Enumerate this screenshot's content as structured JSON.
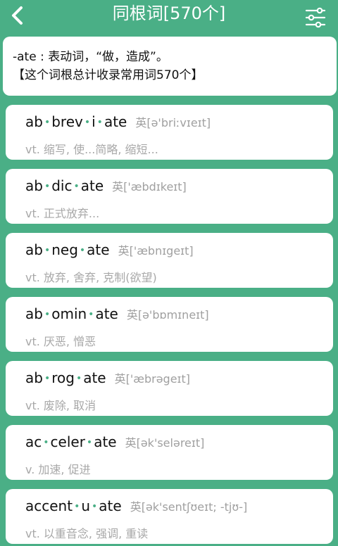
{
  "header": {
    "title": "同根词[570个]",
    "back_icon": "chevron-left-icon",
    "filter_icon": "sliders-icon"
  },
  "intro": {
    "line1": "-ate : 表动词，“做，造成”。",
    "line2": "【这个词根总计收录常用词570个】"
  },
  "words": [
    {
      "parts": [
        "ab",
        "brev",
        "i",
        "ate"
      ],
      "phonetic": "英[ə'briːvɪeɪt]",
      "meaning": "vt. 缩写, 使...简略, 缩短..."
    },
    {
      "parts": [
        "ab",
        "dic",
        "ate"
      ],
      "phonetic": "英['æbdɪkeɪt]",
      "meaning": "vt. 正式放弃..."
    },
    {
      "parts": [
        "ab",
        "neg",
        "ate"
      ],
      "phonetic": "英['æbnɪgeɪt]",
      "meaning": "vt. 放弃, 舍弃, 克制(欲望)"
    },
    {
      "parts": [
        "ab",
        "omin",
        "ate"
      ],
      "phonetic": "英[ə'bɒmɪneɪt]",
      "meaning": "vt. 厌恶, 憎恶"
    },
    {
      "parts": [
        "ab",
        "rog",
        "ate"
      ],
      "phonetic": "英['æbrəgeɪt]",
      "meaning": "vt. 废除, 取消"
    },
    {
      "parts": [
        "ac",
        "celer",
        "ate"
      ],
      "phonetic": "英[ək'seləreɪt]",
      "meaning": "v. 加速, 促进"
    },
    {
      "parts": [
        "accent",
        "u",
        "ate"
      ],
      "phonetic": "英[ək'sentʃʊeɪt; -tjʊ-]",
      "meaning": "vt. 以重音念, 强调, 重读"
    }
  ],
  "colors": {
    "background": "#4aaf86",
    "card": "#ffffff",
    "syllable_dot": "#4aaf86",
    "secondary_text": "#a8a8a8"
  }
}
